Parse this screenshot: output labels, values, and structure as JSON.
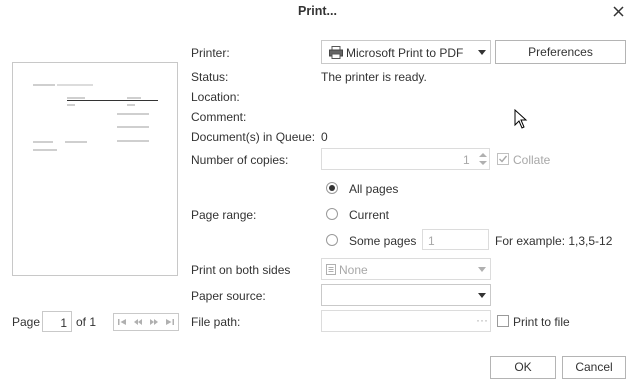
{
  "dialog": {
    "title": "Print..."
  },
  "printer": {
    "label": "Printer:",
    "selected": "Microsoft Print to PDF",
    "preferences_label": "Preferences"
  },
  "status": {
    "label": "Status:",
    "value": "The printer is ready."
  },
  "location": {
    "label": "Location:",
    "value": ""
  },
  "comment": {
    "label": "Comment:",
    "value": ""
  },
  "queue": {
    "label": "Document(s) in Queue:",
    "value": "0"
  },
  "copies": {
    "label": "Number of copies:",
    "value": "1",
    "collate_label": "Collate",
    "collate_checked": true
  },
  "page_range": {
    "label": "Page range:",
    "options": [
      "All pages",
      "Current",
      "Some pages"
    ],
    "selected": "All pages",
    "some_pages_value": "1",
    "example": "For example: 1,3,5-12"
  },
  "both_sides": {
    "label": "Print on both sides",
    "value": "None"
  },
  "paper_source": {
    "label": "Paper source:",
    "value": ""
  },
  "file_path": {
    "label": "File path:",
    "value": "",
    "browse_label": "···",
    "print_to_file_label": "Print to file",
    "print_to_file_checked": false
  },
  "pager": {
    "page_label": "Page",
    "page_value": "1",
    "of_label": "of 1"
  },
  "buttons": {
    "ok": "OK",
    "cancel": "Cancel"
  }
}
